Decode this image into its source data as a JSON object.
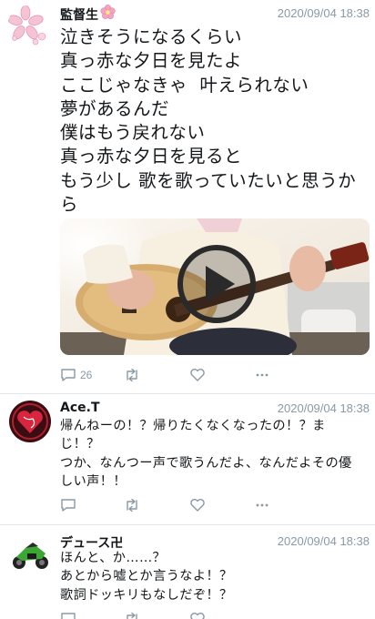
{
  "main_post": {
    "author": "監督生",
    "timestamp": "2020/09/04 18:38",
    "text": "泣きそうになるくらい\n真っ赤な夕日を見たよ\nここじゃなきゃ  叶えられない\n夢があるんだ\n僕はもう戻れない\n真っ赤な夕日を見ると\nもう少し 歌を歌っていたいと思うか\nら",
    "reply_count": "26",
    "media_icon": "play-icon"
  },
  "replies": [
    {
      "author": "Ace.T",
      "timestamp": "2020/09/04 18:38",
      "text": "帰んねーの！？帰りたくなくなったの！？ま\nじ！？\nつか、なんつー声で歌うんだよ、なんだよその優\nしい声！！"
    },
    {
      "author": "デュース卍",
      "timestamp": "2020/09/04 18:38",
      "text": "ほんと、か……？\nあとから嘘とか言うなよ！？\n歌詞ドッキリもなしだぞ！？"
    }
  ],
  "icons": [
    "reply-icon",
    "retweet-icon",
    "like-icon",
    "more-icon",
    "flower-icon"
  ],
  "colors": {
    "meta_gray": "#8899a6",
    "divider": "#e1e6ea",
    "text": "#14171a"
  }
}
